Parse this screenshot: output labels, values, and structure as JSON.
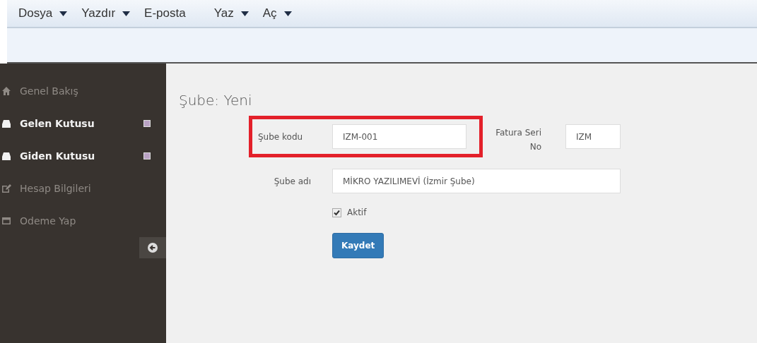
{
  "menu": [
    {
      "label": "Dosya",
      "dropdown": true
    },
    {
      "label": "Yazdır",
      "dropdown": true
    },
    {
      "label": "E-posta",
      "dropdown": false
    },
    {
      "label": "Yaz",
      "dropdown": true
    },
    {
      "label": "Aç",
      "dropdown": true
    }
  ],
  "sidebar": {
    "items": [
      {
        "label": "Genel Bakış",
        "emphasized": false,
        "badge": false
      },
      {
        "label": "Gelen Kutusu",
        "emphasized": true,
        "badge": true
      },
      {
        "label": "Giden Kutusu",
        "emphasized": true,
        "badge": true
      },
      {
        "label": "Hesap Bilgileri",
        "emphasized": false,
        "badge": false
      },
      {
        "label": "Odeme Yap",
        "emphasized": false,
        "badge": false
      }
    ]
  },
  "page_title": "Şube: Yeni",
  "form": {
    "branch_code": {
      "label": "Şube kodu",
      "value": "IZM-001",
      "highlighted": true
    },
    "invoice_series": {
      "label_lines": [
        "Fatura Seri",
        "No"
      ],
      "value": "IZM"
    },
    "branch_name": {
      "label": "Şube adı",
      "value": "MİKRO YAZILIMEVİ (İzmir Şube)"
    },
    "active": {
      "label": "Aktif",
      "checked": true
    },
    "save_button": "Kaydet"
  }
}
